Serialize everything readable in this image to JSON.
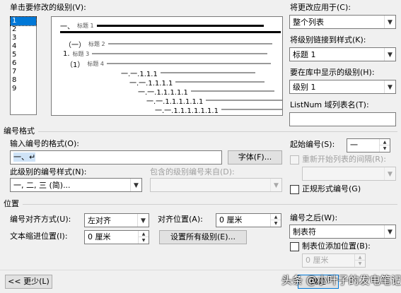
{
  "level_section": {
    "label": "单击要修改的级别(V):",
    "levels": [
      "1",
      "2",
      "3",
      "4",
      "5",
      "6",
      "7",
      "8",
      "9"
    ],
    "selected_level": "1"
  },
  "preview": {
    "rows": [
      {
        "number": "一、",
        "text": "标题 1"
      },
      {
        "number": "（一）",
        "text": "标题 2"
      },
      {
        "number": "1.",
        "text": "标题 3"
      },
      {
        "number": "（1）",
        "text": "标题 4"
      },
      {
        "number": "一.一.1.1.1",
        "text": ""
      },
      {
        "number": "一.一.1.1.1.1",
        "text": ""
      },
      {
        "number": "一.一.1.1.1.1.1",
        "text": ""
      },
      {
        "number": "一.一.1.1.1.1.1.1",
        "text": ""
      },
      {
        "number": "一.一.1.1.1.1.1.1.1",
        "text": ""
      }
    ]
  },
  "right_panel": {
    "apply_to_label": "将更改应用于(C):",
    "apply_to_value": "整个列表",
    "link_style_label": "将级别链接到样式(K):",
    "link_style_value": "标题 1",
    "gallery_level_label": "要在库中显示的级别(H):",
    "gallery_level_value": "级别 1",
    "listnum_label": "ListNum 域列表名(T):",
    "listnum_value": ""
  },
  "number_format": {
    "group_title": "编号格式",
    "enter_format_label": "输入编号的格式(O):",
    "enter_format_value": "一、↵",
    "font_button": "字体(F)...",
    "style_label": "此级别的编号样式(N):",
    "style_value": "一, 二, 三 (简)...",
    "include_from_label": "包含的级别编号来自(D):",
    "include_from_value": "",
    "start_at_label": "起始编号(S):",
    "start_at_value": "一",
    "restart_label": "重新开始列表的间隔(R):",
    "restart_value": "",
    "legal_label": "正规形式编号(G)"
  },
  "position": {
    "group_title": "位置",
    "alignment_label": "编号对齐方式(U):",
    "alignment_value": "左对齐",
    "aligned_at_label": "对齐位置(A):",
    "aligned_at_value": "0 厘米",
    "indent_label": "文本缩进位置(I):",
    "indent_value": "0 厘米",
    "set_all_button": "设置所有级别(E)...",
    "follow_label": "编号之后(W):",
    "follow_value": "制表符",
    "tab_stop_label": "制表位添加位置(B):",
    "tab_stop_value": "0 厘米"
  },
  "footer": {
    "less_button": "<< 更少(L)",
    "ok_button": "确定",
    "watermark": "头条 @小叶子的发电笔记"
  }
}
